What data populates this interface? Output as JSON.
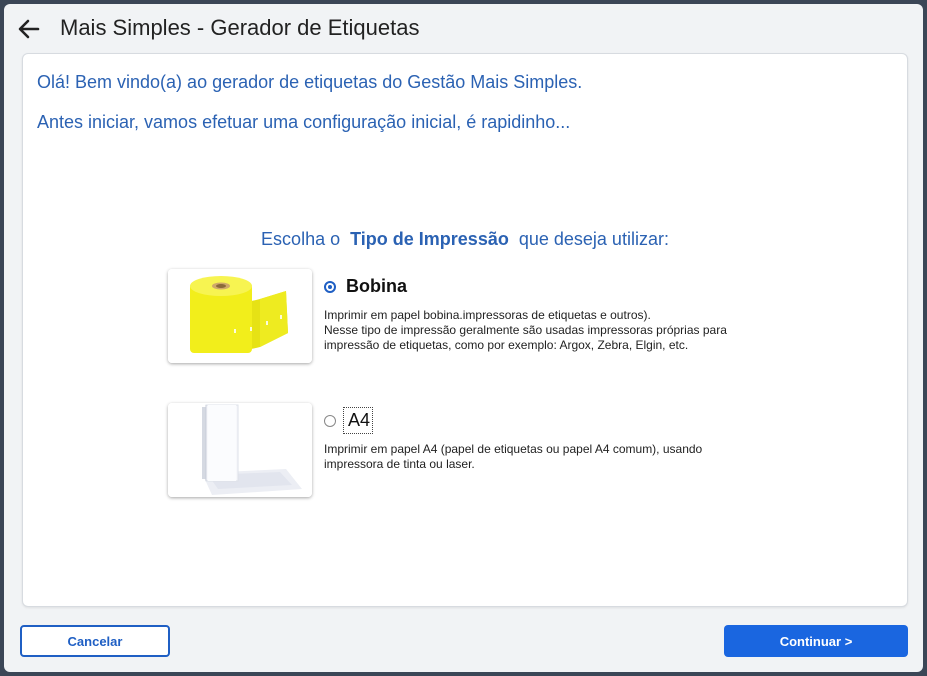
{
  "header": {
    "title": "Mais Simples - Gerador de Etiquetas",
    "back_icon": "arrow-left-icon"
  },
  "welcome": {
    "line1": "Olá! Bem vindo(a) ao gerador de etiquetas do Gestão Mais Simples.",
    "line2": "Antes iniciar, vamos efetuar uma configuração inicial, é rapidinho..."
  },
  "prompt": {
    "prefix": "Escolha o",
    "emphasis": "Tipo de Impressão",
    "suffix": "que deseja utilizar:"
  },
  "options": [
    {
      "label": "Bobina",
      "selected": true,
      "description": [
        "Imprimir em papel bobina.impressoras de etiquetas e outros).",
        "Nesse tipo de impressão geralmente são usadas impressoras próprias para",
        "impressão de etiquetas, como por exemplo: Argox, Zebra, Elgin, etc."
      ],
      "image": "yellow-label-roll-image"
    },
    {
      "label": "A4",
      "selected": false,
      "description": [
        "Imprimir em papel A4 (papel de etiquetas ou papel A4 comum), usando",
        "impressora de tinta ou laser."
      ],
      "image": "a4-paper-stack-image"
    }
  ],
  "footer": {
    "cancel_label": "Cancelar",
    "continue_label": "Continuar >"
  },
  "colors": {
    "accent": "#1a66e0",
    "text_blue": "#2b62b3",
    "roll_yellow": "#f2ee1b"
  }
}
